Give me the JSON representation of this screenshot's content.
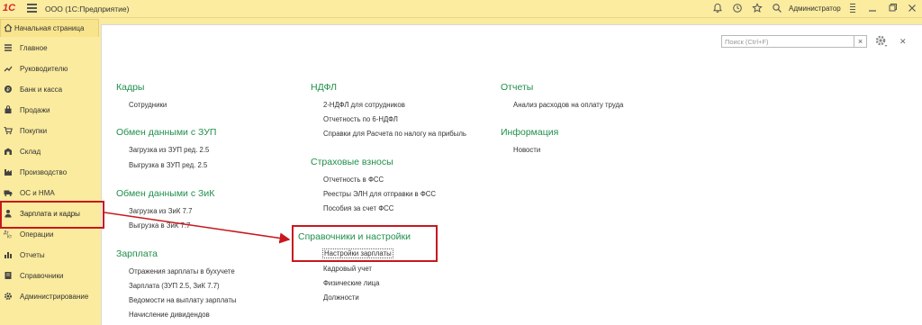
{
  "topbar": {
    "logo": "1С",
    "title": "ООО (1С:Предприятие)",
    "user": "Администратор"
  },
  "home_tab": {
    "label": "Начальная страница"
  },
  "sidebar": {
    "items": [
      {
        "label": "Главное",
        "icon": "list-icon"
      },
      {
        "label": "Руководителю",
        "icon": "trend-icon"
      },
      {
        "label": "Банк и касса",
        "icon": "coin-icon"
      },
      {
        "label": "Продажи",
        "icon": "bag-icon"
      },
      {
        "label": "Покупки",
        "icon": "cart-icon"
      },
      {
        "label": "Склад",
        "icon": "warehouse-icon"
      },
      {
        "label": "Производство",
        "icon": "factory-icon"
      },
      {
        "label": "ОС и НМА",
        "icon": "truck-icon"
      },
      {
        "label": "Зарплата и кадры",
        "icon": "person-icon"
      },
      {
        "label": "Операции",
        "icon": "operations-icon"
      },
      {
        "label": "Отчеты",
        "icon": "chart-icon"
      },
      {
        "label": "Справочники",
        "icon": "book-icon"
      },
      {
        "label": "Администрирование",
        "icon": "gear-icon"
      }
    ]
  },
  "search": {
    "placeholder": "Поиск (Ctrl+F)",
    "clear": "×"
  },
  "sections": {
    "kadry": {
      "title": "Кадры",
      "links": [
        "Сотрудники"
      ]
    },
    "zup": {
      "title": "Обмен данными с ЗУП",
      "links": [
        "Загрузка из ЗУП ред. 2.5",
        "Выгрузка в ЗУП ред. 2.5"
      ]
    },
    "zik": {
      "title": "Обмен данными с ЗиК",
      "links": [
        "Загрузка из ЗиК 7.7",
        "Выгрузка в ЗиК 7.7"
      ]
    },
    "zarplata": {
      "title": "Зарплата",
      "links": [
        "Отражения зарплаты в бухучете",
        "Зарплата (ЗУП 2.5, ЗиК 7.7)",
        "Ведомости на выплату зарплаты",
        "Начисление дивидендов"
      ]
    },
    "ndfl": {
      "title": "НДФЛ",
      "links": [
        "2-НДФЛ для сотрудников",
        "Отчетность по 6-НДФЛ",
        "Справки для Расчета по налогу на прибыль"
      ]
    },
    "strah": {
      "title": "Страховые взносы",
      "links": [
        "Отчетность в ФСС",
        "Реестры ЭЛН для отправки в ФСС",
        "Пособия за счет ФСС"
      ]
    },
    "sprav": {
      "title": "Справочники и настройки",
      "links": [
        "Настройки зарплаты",
        "Кадровый учет",
        "Физические лица",
        "Должности"
      ]
    },
    "otchety": {
      "title": "Отчеты",
      "links": [
        "Анализ расходов на оплату труда"
      ]
    },
    "info": {
      "title": "Информация",
      "links": [
        "Новости"
      ]
    }
  },
  "colors": {
    "accent": "#1f8f4a",
    "highlight": "#c8181e",
    "sidebar_bg": "#fbeb9e"
  }
}
